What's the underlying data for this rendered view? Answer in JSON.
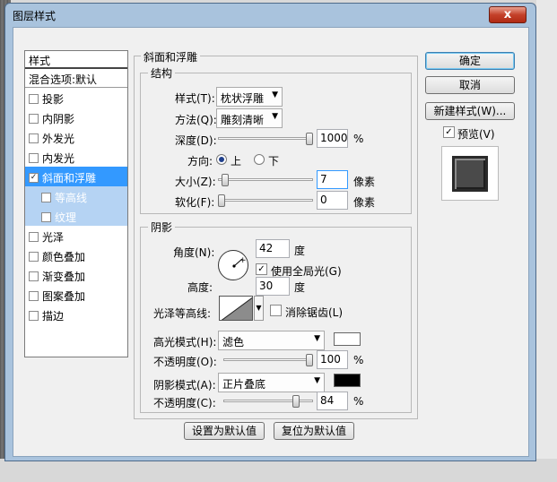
{
  "window": {
    "title": "图层样式",
    "close_label": "x"
  },
  "style_list": {
    "header": "样式",
    "blend_options": "混合选项:默认",
    "items": [
      {
        "label": "投影",
        "checked": false
      },
      {
        "label": "内阴影",
        "checked": false
      },
      {
        "label": "外发光",
        "checked": false
      },
      {
        "label": "内发光",
        "checked": false
      },
      {
        "label": "斜面和浮雕",
        "checked": true,
        "selected": true
      },
      {
        "label": "等高线",
        "checked": false,
        "sub": true
      },
      {
        "label": "纹理",
        "checked": false,
        "sub": true
      },
      {
        "label": "光泽",
        "checked": false
      },
      {
        "label": "颜色叠加",
        "checked": false
      },
      {
        "label": "渐变叠加",
        "checked": false
      },
      {
        "label": "图案叠加",
        "checked": false
      },
      {
        "label": "描边",
        "checked": false
      }
    ]
  },
  "bevel": {
    "group_title": "斜面和浮雕",
    "structure": {
      "title": "结构",
      "style_label": "样式(T):",
      "style_value": "枕状浮雕",
      "technique_label": "方法(Q):",
      "technique_value": "雕刻清晰",
      "depth_label": "深度(D):",
      "depth_value": "1000",
      "depth_unit": "%",
      "depth_level": 1.0,
      "direction_label": "方向:",
      "direction_up": "上",
      "direction_down": "下",
      "direction_selected": "上",
      "size_label": "大小(Z):",
      "size_value": "7",
      "size_unit": "像素",
      "size_level": 0.04,
      "soften_label": "软化(F):",
      "soften_value": "0",
      "soften_unit": "像素",
      "soften_level": 0.0
    },
    "shading": {
      "title": "阴影",
      "angle_label": "角度(N):",
      "angle_value": "42",
      "angle_unit": "度",
      "global_light_label": "使用全局光(G)",
      "global_light_checked": true,
      "altitude_label": "高度:",
      "altitude_value": "30",
      "altitude_unit": "度",
      "gloss_contour_label": "光泽等高线:",
      "anti_alias_label": "消除锯齿(L)",
      "anti_alias_checked": false,
      "highlight_mode_label": "高光模式(H):",
      "highlight_mode_value": "滤色",
      "highlight_color": "#ffffff",
      "highlight_opacity_label": "不透明度(O):",
      "highlight_opacity_value": "100",
      "highlight_opacity_unit": "%",
      "highlight_opacity_level": 1.0,
      "shadow_mode_label": "阴影模式(A):",
      "shadow_mode_value": "正片叠底",
      "shadow_color": "#000000",
      "shadow_opacity_label": "不透明度(C):",
      "shadow_opacity_value": "84",
      "shadow_opacity_unit": "%",
      "shadow_opacity_level": 0.84
    },
    "make_default_label": "设置为默认值",
    "reset_default_label": "复位为默认值"
  },
  "buttons": {
    "ok": "确定",
    "cancel": "取消",
    "new_style": "新建样式(W)...",
    "preview_label": "预览(V)",
    "preview_checked": true
  }
}
